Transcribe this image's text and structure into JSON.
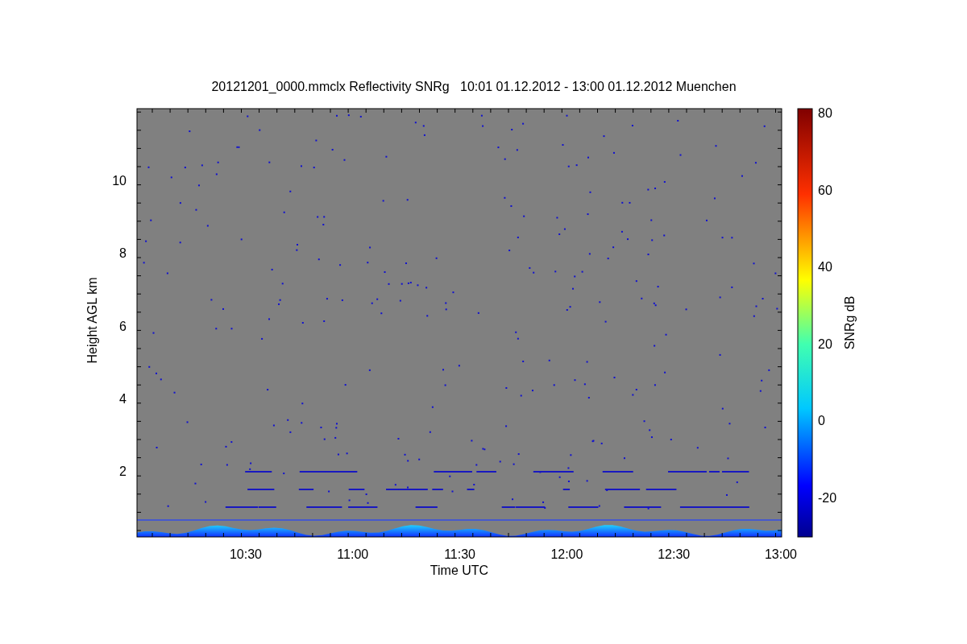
{
  "figure": {
    "title": "20121201_0000.mmclx Reflectivity SNRg   10:01 01.12.2012 - 13:00 01.12.2012 Muenchen",
    "ylabel": "Height AGL km",
    "xlabel": "Time UTC",
    "yticks": [
      "10",
      "8",
      "6",
      "4",
      "2"
    ],
    "xticks": [
      "10:30",
      "11:00",
      "11:30",
      "12:00",
      "12:30",
      "13:00"
    ],
    "colorbar": {
      "label": "SNRg dB",
      "ticks": [
        "80",
        "60",
        "40",
        "20",
        "0",
        "-20"
      ]
    }
  }
}
